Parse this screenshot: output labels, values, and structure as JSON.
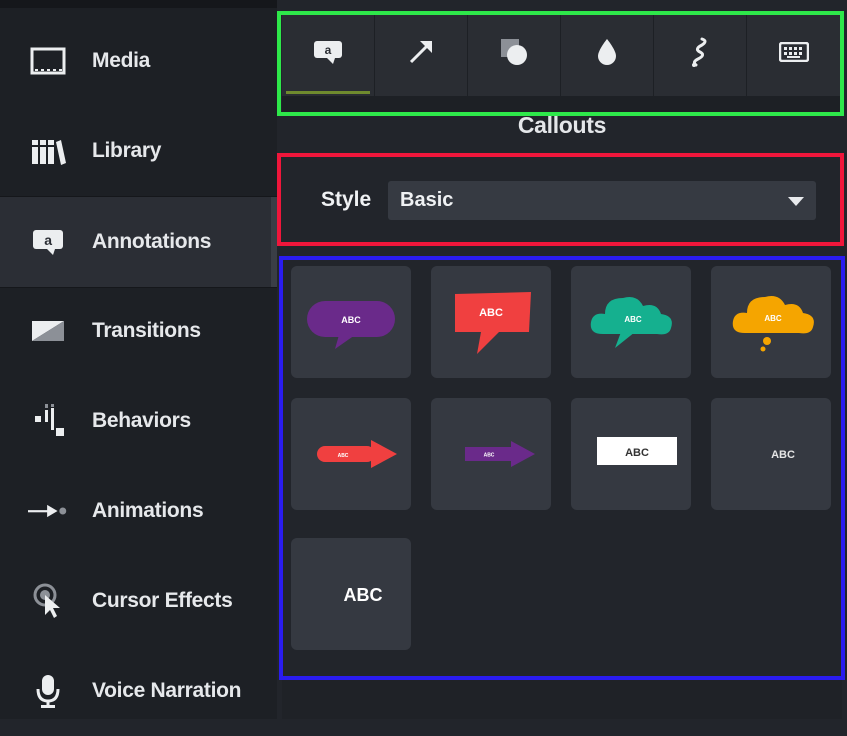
{
  "sidebar": {
    "items": [
      {
        "label": "Media",
        "icon": "film-icon"
      },
      {
        "label": "Library",
        "icon": "library-icon"
      },
      {
        "label": "Annotations",
        "icon": "annotation-icon",
        "active": true
      },
      {
        "label": "Transitions",
        "icon": "transition-icon"
      },
      {
        "label": "Behaviors",
        "icon": "behaviors-icon"
      },
      {
        "label": "Animations",
        "icon": "animation-icon"
      },
      {
        "label": "Cursor Effects",
        "icon": "cursor-icon"
      },
      {
        "label": "Voice Narration",
        "icon": "microphone-icon"
      }
    ]
  },
  "toolbar": {
    "tabs": [
      {
        "icon": "callout-icon",
        "active": true
      },
      {
        "icon": "arrow-icon"
      },
      {
        "icon": "shape-icon"
      },
      {
        "icon": "blur-drop-icon"
      },
      {
        "icon": "sketch-icon"
      },
      {
        "icon": "keyboard-icon"
      }
    ]
  },
  "section": {
    "title": "Callouts"
  },
  "style": {
    "label": "Style",
    "value": "Basic"
  },
  "tiles": [
    {
      "text": "ABC",
      "color": "#6a2a8a"
    },
    {
      "text": "ABC",
      "color": "#f04040"
    },
    {
      "text": "ABC",
      "color": "#15b08f"
    },
    {
      "text": "ABC",
      "color": "#f5a500"
    },
    {
      "text": "ABC",
      "color": "#f04040"
    },
    {
      "text": "ABC",
      "color": "#6a2a8a"
    },
    {
      "text": "ABC",
      "color": "#ffffff"
    },
    {
      "text": "ABC",
      "color": "#e6e6e6"
    },
    {
      "text": "ABC",
      "color": "#ffffff"
    }
  ],
  "highlights": {
    "green": "#2ee84a",
    "red": "#f0163b",
    "blue": "#2a1cf0"
  }
}
